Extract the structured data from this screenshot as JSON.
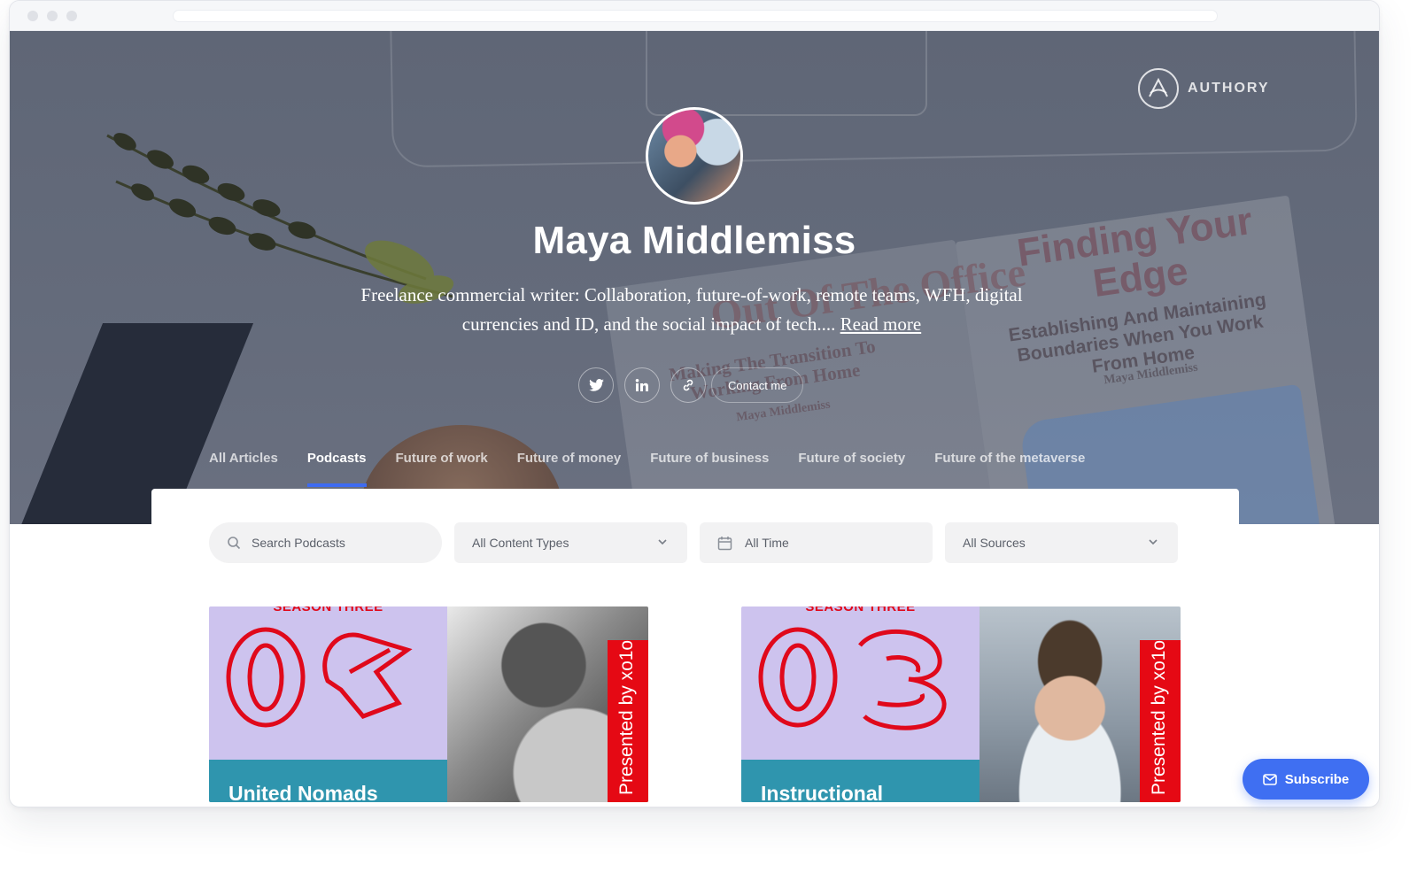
{
  "brand": {
    "name": "AUTHORY"
  },
  "profile": {
    "name": "Maya Middlemiss",
    "bio": "Freelance commercial writer: Collaboration, future-of-work, remote teams, WFH, digital currencies and ID, and the social impact of tech....",
    "read_more": "Read more"
  },
  "social": {
    "twitter_icon": "twitter-icon",
    "linkedin_icon": "linkedin-icon",
    "link_icon": "link-icon",
    "contact_label": "Contact me"
  },
  "background_text": {
    "book1_title": "Out Of The Office",
    "book1_subtitle_1": "Making The Transition To",
    "book1_subtitle_2": "Working From Home",
    "book1_author": "Maya Middlemiss",
    "book2_title_1": "Finding Your",
    "book2_title_2": "Edge",
    "book2_subtitle_1": "Establishing And Maintaining",
    "book2_subtitle_2": "Boundaries When You Work",
    "book2_subtitle_3": "From Home",
    "book2_author": "Maya Middlemiss"
  },
  "tabs": [
    {
      "label": "All Articles"
    },
    {
      "label": "Podcasts",
      "active": true
    },
    {
      "label": "Future of work"
    },
    {
      "label": "Future of money"
    },
    {
      "label": "Future of business"
    },
    {
      "label": "Future of society"
    },
    {
      "label": "Future of the metaverse"
    }
  ],
  "filters": {
    "search_placeholder": "Search Podcasts",
    "content_types": "All Content Types",
    "time": "All Time",
    "sources": "All Sources"
  },
  "cards": [
    {
      "season": "SEASON THREE",
      "title": "United Nomads",
      "strip": "Presented by xo1o"
    },
    {
      "season": "SEASON THREE",
      "title": "Instructional",
      "strip": "Presented by xo1o"
    }
  ],
  "subscribe": {
    "label": "Subscribe"
  },
  "colors": {
    "accent": "#3e6bf2",
    "card_lilac": "#cdc3ee",
    "card_band": "#2f95ae",
    "brand_red": "#e50914"
  }
}
